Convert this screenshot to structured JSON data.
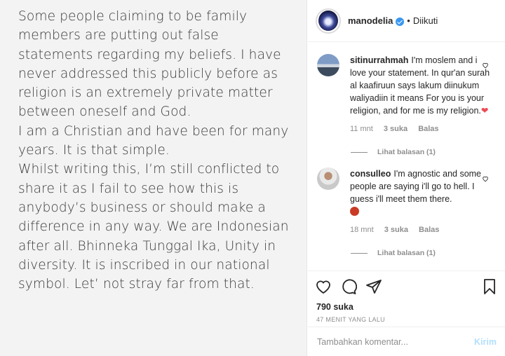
{
  "post": {
    "text": [
      "Some people claiming to be family members are putting out false statements regarding my beliefs. I have never addressed this publicly before as religion is an extremely private matter between oneself and God.",
      "I am a Christian and have been for many years. It is that simple.",
      "Whilst writing this, I’m still conflicted to share it as I fail to see how this is anybody’s business or should make a difference in any way. We are Indonesian after all. Bhinneka Tunggal Ika, Unity in diversity. It is inscribed in our national symbol. Let’ not stray far from that."
    ]
  },
  "header": {
    "username": "manodelia",
    "separator": "•",
    "follow_status": "Diikuti"
  },
  "comments": [
    {
      "username": "sitinurrahmah",
      "text": "I'm moslem and i love your statement. In qur'an surah al kaafiruun says lakum diinukum waliyadiin it means For you is your religion, and for me is my religion.",
      "emoji": "❤",
      "time": "11 mnt",
      "likes": "3 suka",
      "reply": "Balas",
      "view_replies": "Lihat balasan (1)"
    },
    {
      "username": "consulleo",
      "text": "I'm agnostic and some people are saying i'll go to hell. I guess i'll meet them there.",
      "emoji": "devil-emoji",
      "time": "18 mnt",
      "likes": "3 suka",
      "reply": "Balas",
      "view_replies": "Lihat balasan (1)"
    }
  ],
  "actions": {
    "likes": "790 suka",
    "time": "47 MENIT YANG LALU"
  },
  "add_comment": {
    "placeholder": "Tambahkan komentar...",
    "post_label": "Kirim"
  },
  "colors": {
    "verified": "#3897f0",
    "heart": "#ed4956",
    "post_button": "#b2dffc",
    "muted": "#8e8e8e"
  }
}
